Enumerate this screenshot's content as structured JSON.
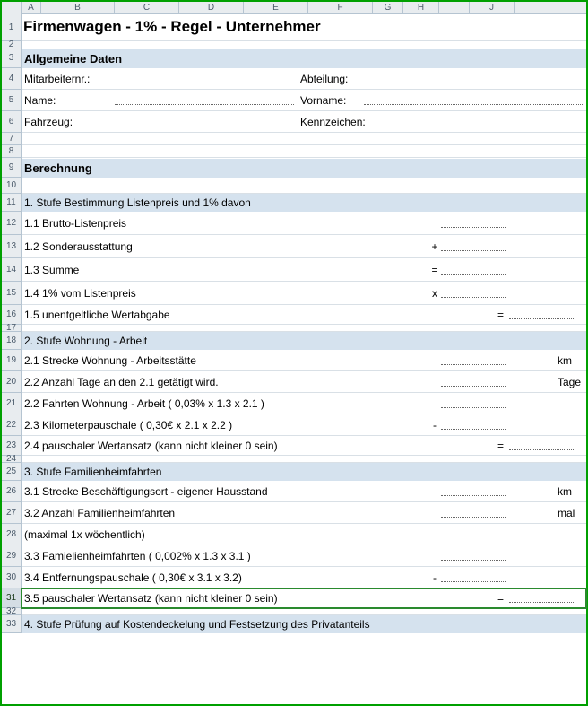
{
  "columns": [
    "A",
    "B",
    "C",
    "D",
    "E",
    "F",
    "G",
    "H",
    "I",
    "J"
  ],
  "rows": [
    "1",
    "2",
    "3",
    "4",
    "5",
    "6",
    "7",
    "8",
    "9",
    "10",
    "11",
    "12",
    "13",
    "14",
    "15",
    "16",
    "17",
    "18",
    "19",
    "20",
    "21",
    "22",
    "23",
    "24",
    "25",
    "26",
    "27",
    "28",
    "29",
    "30",
    "31",
    "32",
    "33"
  ],
  "selected_row": "31",
  "title": "Firmenwagen - 1% - Regel - Unternehmer",
  "section_allgemein": {
    "header": "Allgemeine Daten",
    "mitarbeiter_lbl": "Mitarbeiternr.:",
    "abteilung_lbl": "Abteilung:",
    "name_lbl": "Name:",
    "vorname_lbl": "Vorname:",
    "fahrzeug_lbl": "Fahrzeug:",
    "kennzeichen_lbl": "Kennzeichen:"
  },
  "section_berechnung": {
    "header": "Berechnung"
  },
  "stufe1": {
    "header": "1. Stufe Bestimmung Listenpreis und 1% davon",
    "r1": "1.1  Brutto-Listenpreis",
    "r2": "1.2  Sonderausstattung",
    "r3": "1.3  Summe",
    "r4": "1.4  1% vom Listenpreis",
    "r5": "1.5  unentgeltliche Wertabgabe",
    "op2": "+",
    "op3": "=",
    "op4": "x",
    "op5": "="
  },
  "stufe2": {
    "header": "2. Stufe  Wohnung - Arbeit",
    "r1": "2.1   Strecke Wohnung - Arbeitsstätte",
    "r1u": "km",
    "r2": "2.2   Anzahl Tage an den 2.1 getätigt wird.",
    "r2u": "Tage",
    "r3": "2.2   Fahrten Wohnung - Arbeit ( 0,03% x 1.3 x 2.1 )",
    "r4": "2.3   Kilometerpauschale ( 0,30€ x 2.1 x 2.2 )",
    "op4": "-",
    "r5": "2.4   pauschaler Wertansatz (kann nicht kleiner 0 sein)",
    "op5": "="
  },
  "stufe3": {
    "header": "3. Stufe Familienheimfahrten",
    "r1": "3.1   Strecke Beschäftigungsort - eigener Hausstand",
    "r1u": "km",
    "r2": "3.2   Anzahl Familienheimfahrten",
    "r2u": "mal",
    "r2b": "        (maximal 1x wöchentlich)",
    "r3": "3.3   Famielienheimfahrten ( 0,002% x 1.3 x 3.1 )",
    "r4": "3.4   Entfernungspauschale ( 0,30€ x 3.1 x 3.2)",
    "op4": "-",
    "r5": "3.5   pauschaler Wertansatz (kann nicht kleiner 0 sein)",
    "op5": "="
  },
  "stufe4": {
    "header": "4. Stufe Prüfung auf Kostendeckelung und Festsetzung des Privatanteils"
  }
}
